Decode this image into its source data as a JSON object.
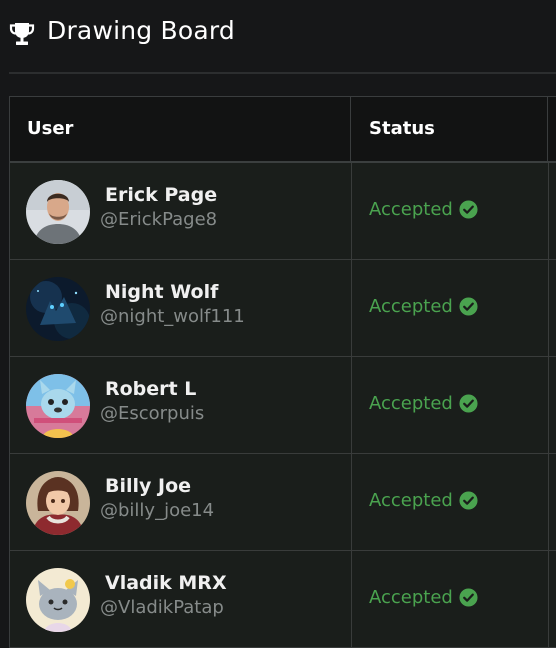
{
  "header": {
    "title": "Drawing Board",
    "icon": "trophy-icon"
  },
  "table": {
    "columns": [
      "User",
      "Status"
    ],
    "rows": [
      {
        "name": "Erick Page",
        "handle": "@ErickPage8",
        "status": "Accepted",
        "avatar": "person-photo"
      },
      {
        "name": "Night Wolf",
        "handle": "@night_wolf111",
        "status": "Accepted",
        "avatar": "wolf-art"
      },
      {
        "name": "Robert L",
        "handle": "@Escorpuis",
        "status": "Accepted",
        "avatar": "cartoon-dog"
      },
      {
        "name": "Billy Joe",
        "handle": "@billy_joe14",
        "status": "Accepted",
        "avatar": "anime-girl"
      },
      {
        "name": "Vladik MRX",
        "handle": "@VladikPatap",
        "status": "Accepted",
        "avatar": "cartoon-cat"
      }
    ]
  },
  "colors": {
    "background": "#161718",
    "row_background": "#1a1e1b",
    "accepted": "#4aa34f",
    "handle": "#868b8a",
    "border": "#393c3b"
  }
}
